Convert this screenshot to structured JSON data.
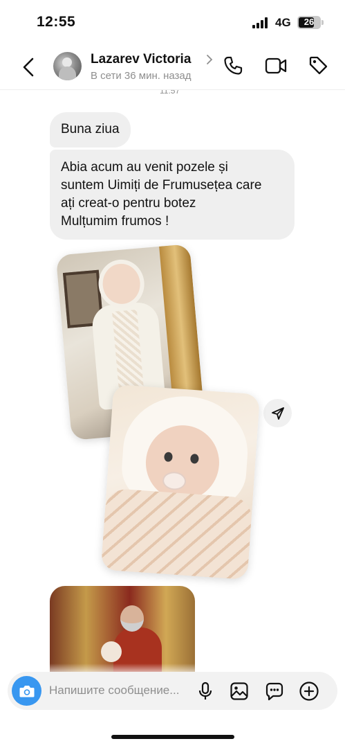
{
  "status_bar": {
    "time": "12:55",
    "network": "4G",
    "battery": "26"
  },
  "header": {
    "contact_name": "Lazarev Victoria",
    "status": "В сети 36 мин. назад",
    "icons": [
      "back-chevron-icon",
      "phone-icon",
      "video-camera-icon",
      "tag-icon"
    ]
  },
  "conversation": {
    "time_label": "11:57",
    "messages": [
      {
        "lines": [
          "Buna ziua"
        ]
      },
      {
        "lines": [
          "Abia acum au venit pozele și",
          "suntem Uimiți de Frumusețea care",
          "ați creat-o pentru botez",
          "Mulțumim frumos !"
        ]
      }
    ],
    "photos": [
      "baby-christening-photo",
      "baby-in-hood-photo",
      "priest-with-baby-photo"
    ]
  },
  "composer": {
    "placeholder": "Напишите сообщение...",
    "icons": [
      "camera-icon",
      "microphone-icon",
      "gallery-icon",
      "sticker-icon",
      "plus-icon"
    ]
  },
  "colors": {
    "accent": "#3897f0",
    "bubble": "#efefef",
    "secondary_text": "#8e8e8e"
  }
}
